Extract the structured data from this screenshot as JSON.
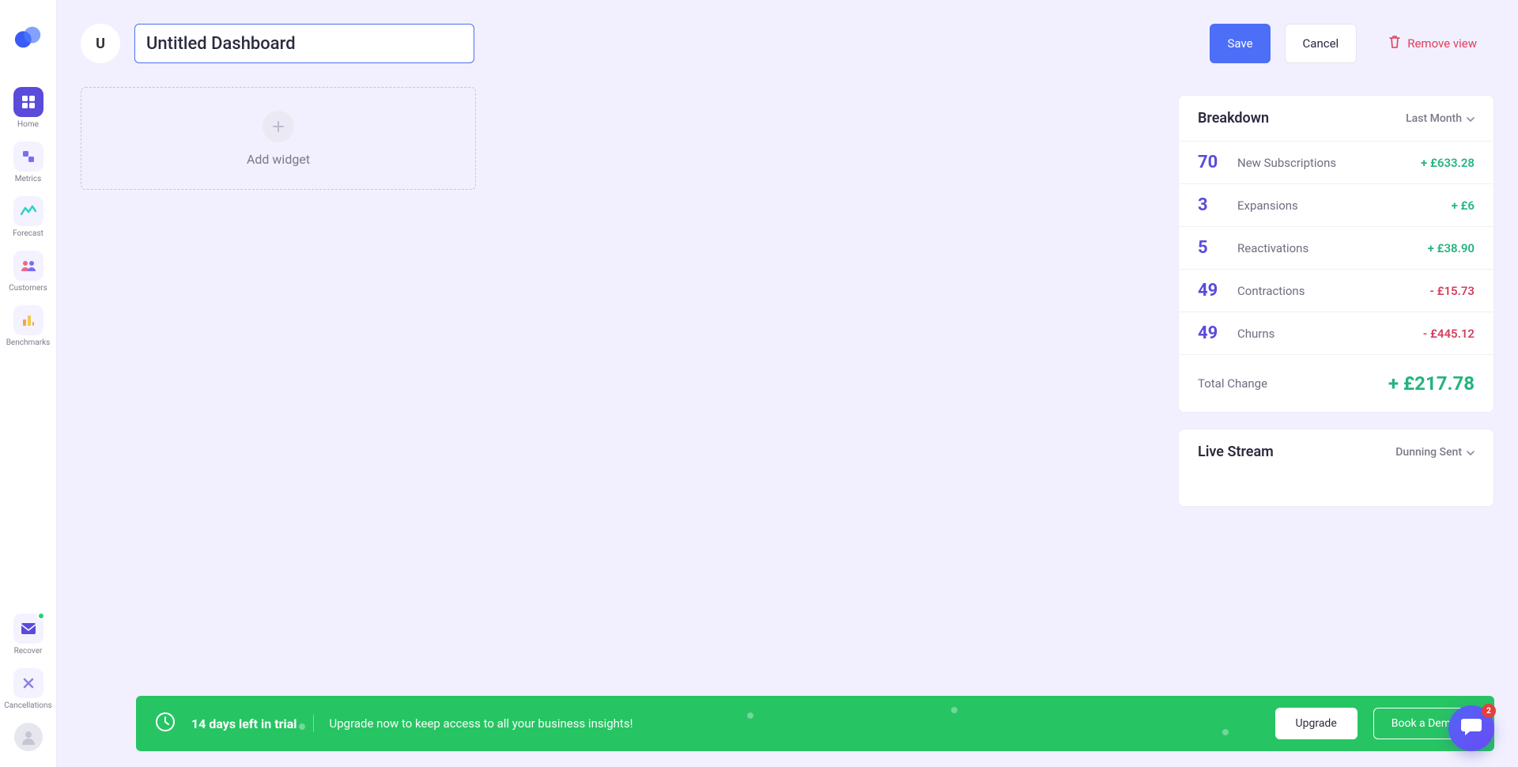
{
  "sidebar": {
    "items": [
      {
        "label": "Home",
        "icon": "grid"
      },
      {
        "label": "Metrics",
        "icon": "squares"
      },
      {
        "label": "Forecast",
        "icon": "wave"
      },
      {
        "label": "Customers",
        "icon": "people"
      },
      {
        "label": "Benchmarks",
        "icon": "bars"
      },
      {
        "label": "Recover",
        "icon": "mail"
      },
      {
        "label": "Cancellations",
        "icon": "cancel"
      }
    ]
  },
  "header": {
    "avatar_letter": "U",
    "title_value": "Untitled Dashboard",
    "save_label": "Save",
    "cancel_label": "Cancel",
    "remove_label": "Remove view"
  },
  "add_widget_label": "Add widget",
  "breakdown": {
    "title": "Breakdown",
    "period": "Last Month",
    "rows": [
      {
        "count": "70",
        "label": "New Subscriptions",
        "delta": "+ £633.28",
        "sign": "pos"
      },
      {
        "count": "3",
        "label": "Expansions",
        "delta": "+ £6",
        "sign": "pos"
      },
      {
        "count": "5",
        "label": "Reactivations",
        "delta": "+ £38.90",
        "sign": "pos"
      },
      {
        "count": "49",
        "label": "Contractions",
        "delta": "- £15.73",
        "sign": "neg"
      },
      {
        "count": "49",
        "label": "Churns",
        "delta": "- £445.12",
        "sign": "neg"
      }
    ],
    "total_label": "Total Change",
    "total_value": "+ £217.78"
  },
  "livestream": {
    "title": "Live Stream",
    "filter": "Dunning Sent"
  },
  "banner": {
    "headline": "14 days left in trial",
    "subtext": "Upgrade now to keep access to all your business insights!",
    "upgrade_label": "Upgrade",
    "demo_label": "Book a Demo"
  },
  "chat": {
    "badge": "2"
  }
}
